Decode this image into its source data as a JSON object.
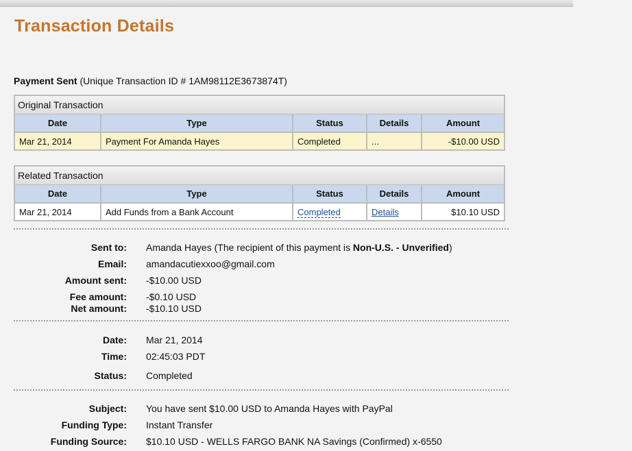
{
  "page": {
    "title": "Transaction Details"
  },
  "payment_header": {
    "status_label": "Payment Sent",
    "transaction_id_text": "(Unique Transaction ID # 1AM98112E3673874T)"
  },
  "original_transaction": {
    "title": "Original Transaction",
    "columns": [
      "Date",
      "Type",
      "Status",
      "Details",
      "Amount"
    ],
    "row": {
      "date": "Mar 21, 2014",
      "type": "Payment For Amanda Hayes",
      "status": "Completed",
      "details": "...",
      "amount": "-$10.00 USD"
    }
  },
  "related_transaction": {
    "title": "Related Transaction",
    "columns": [
      "Date",
      "Type",
      "Status",
      "Details",
      "Amount"
    ],
    "row": {
      "date": "Mar 21, 2014",
      "type": "Add Funds from a Bank Account",
      "status": "Completed",
      "details": "Details",
      "amount": "$10.10 USD"
    }
  },
  "recipient": {
    "sent_to_label": "Sent to:",
    "sent_to_name": "Amanda Hayes",
    "sent_to_note_prefix": "(The recipient of this payment is ",
    "sent_to_note_status": "Non-U.S. - Unverified",
    "sent_to_note_suffix": ")",
    "email_label": "Email:",
    "email_value": "amandacutiexxoo@gmail.com",
    "amount_sent_label": "Amount sent:",
    "amount_sent_value": "-$10.00 USD",
    "fee_amount_label": "Fee amount:",
    "fee_amount_value": "-$0.10 USD",
    "net_amount_label": "Net amount:",
    "net_amount_value": "-$10.10 USD"
  },
  "timing": {
    "date_label": "Date:",
    "date_value": "Mar 21, 2014",
    "time_label": "Time:",
    "time_value": "02:45:03 PDT",
    "status_label": "Status:",
    "status_value": "Completed"
  },
  "funding": {
    "subject_label": "Subject:",
    "subject_value": "You have sent $10.00 USD to Amanda Hayes with PayPal",
    "funding_type_label": "Funding Type:",
    "funding_type_value": "Instant Transfer",
    "funding_source_label": "Funding Source:",
    "funding_source_value": "$10.10 USD - WELLS FARGO BANK NA Savings (Confirmed) x-6550"
  },
  "colors": {
    "title": "#c4752a",
    "table_header": "#c9d8ec",
    "highlight_row": "#fbf4cd",
    "link": "#1a4f9a"
  }
}
